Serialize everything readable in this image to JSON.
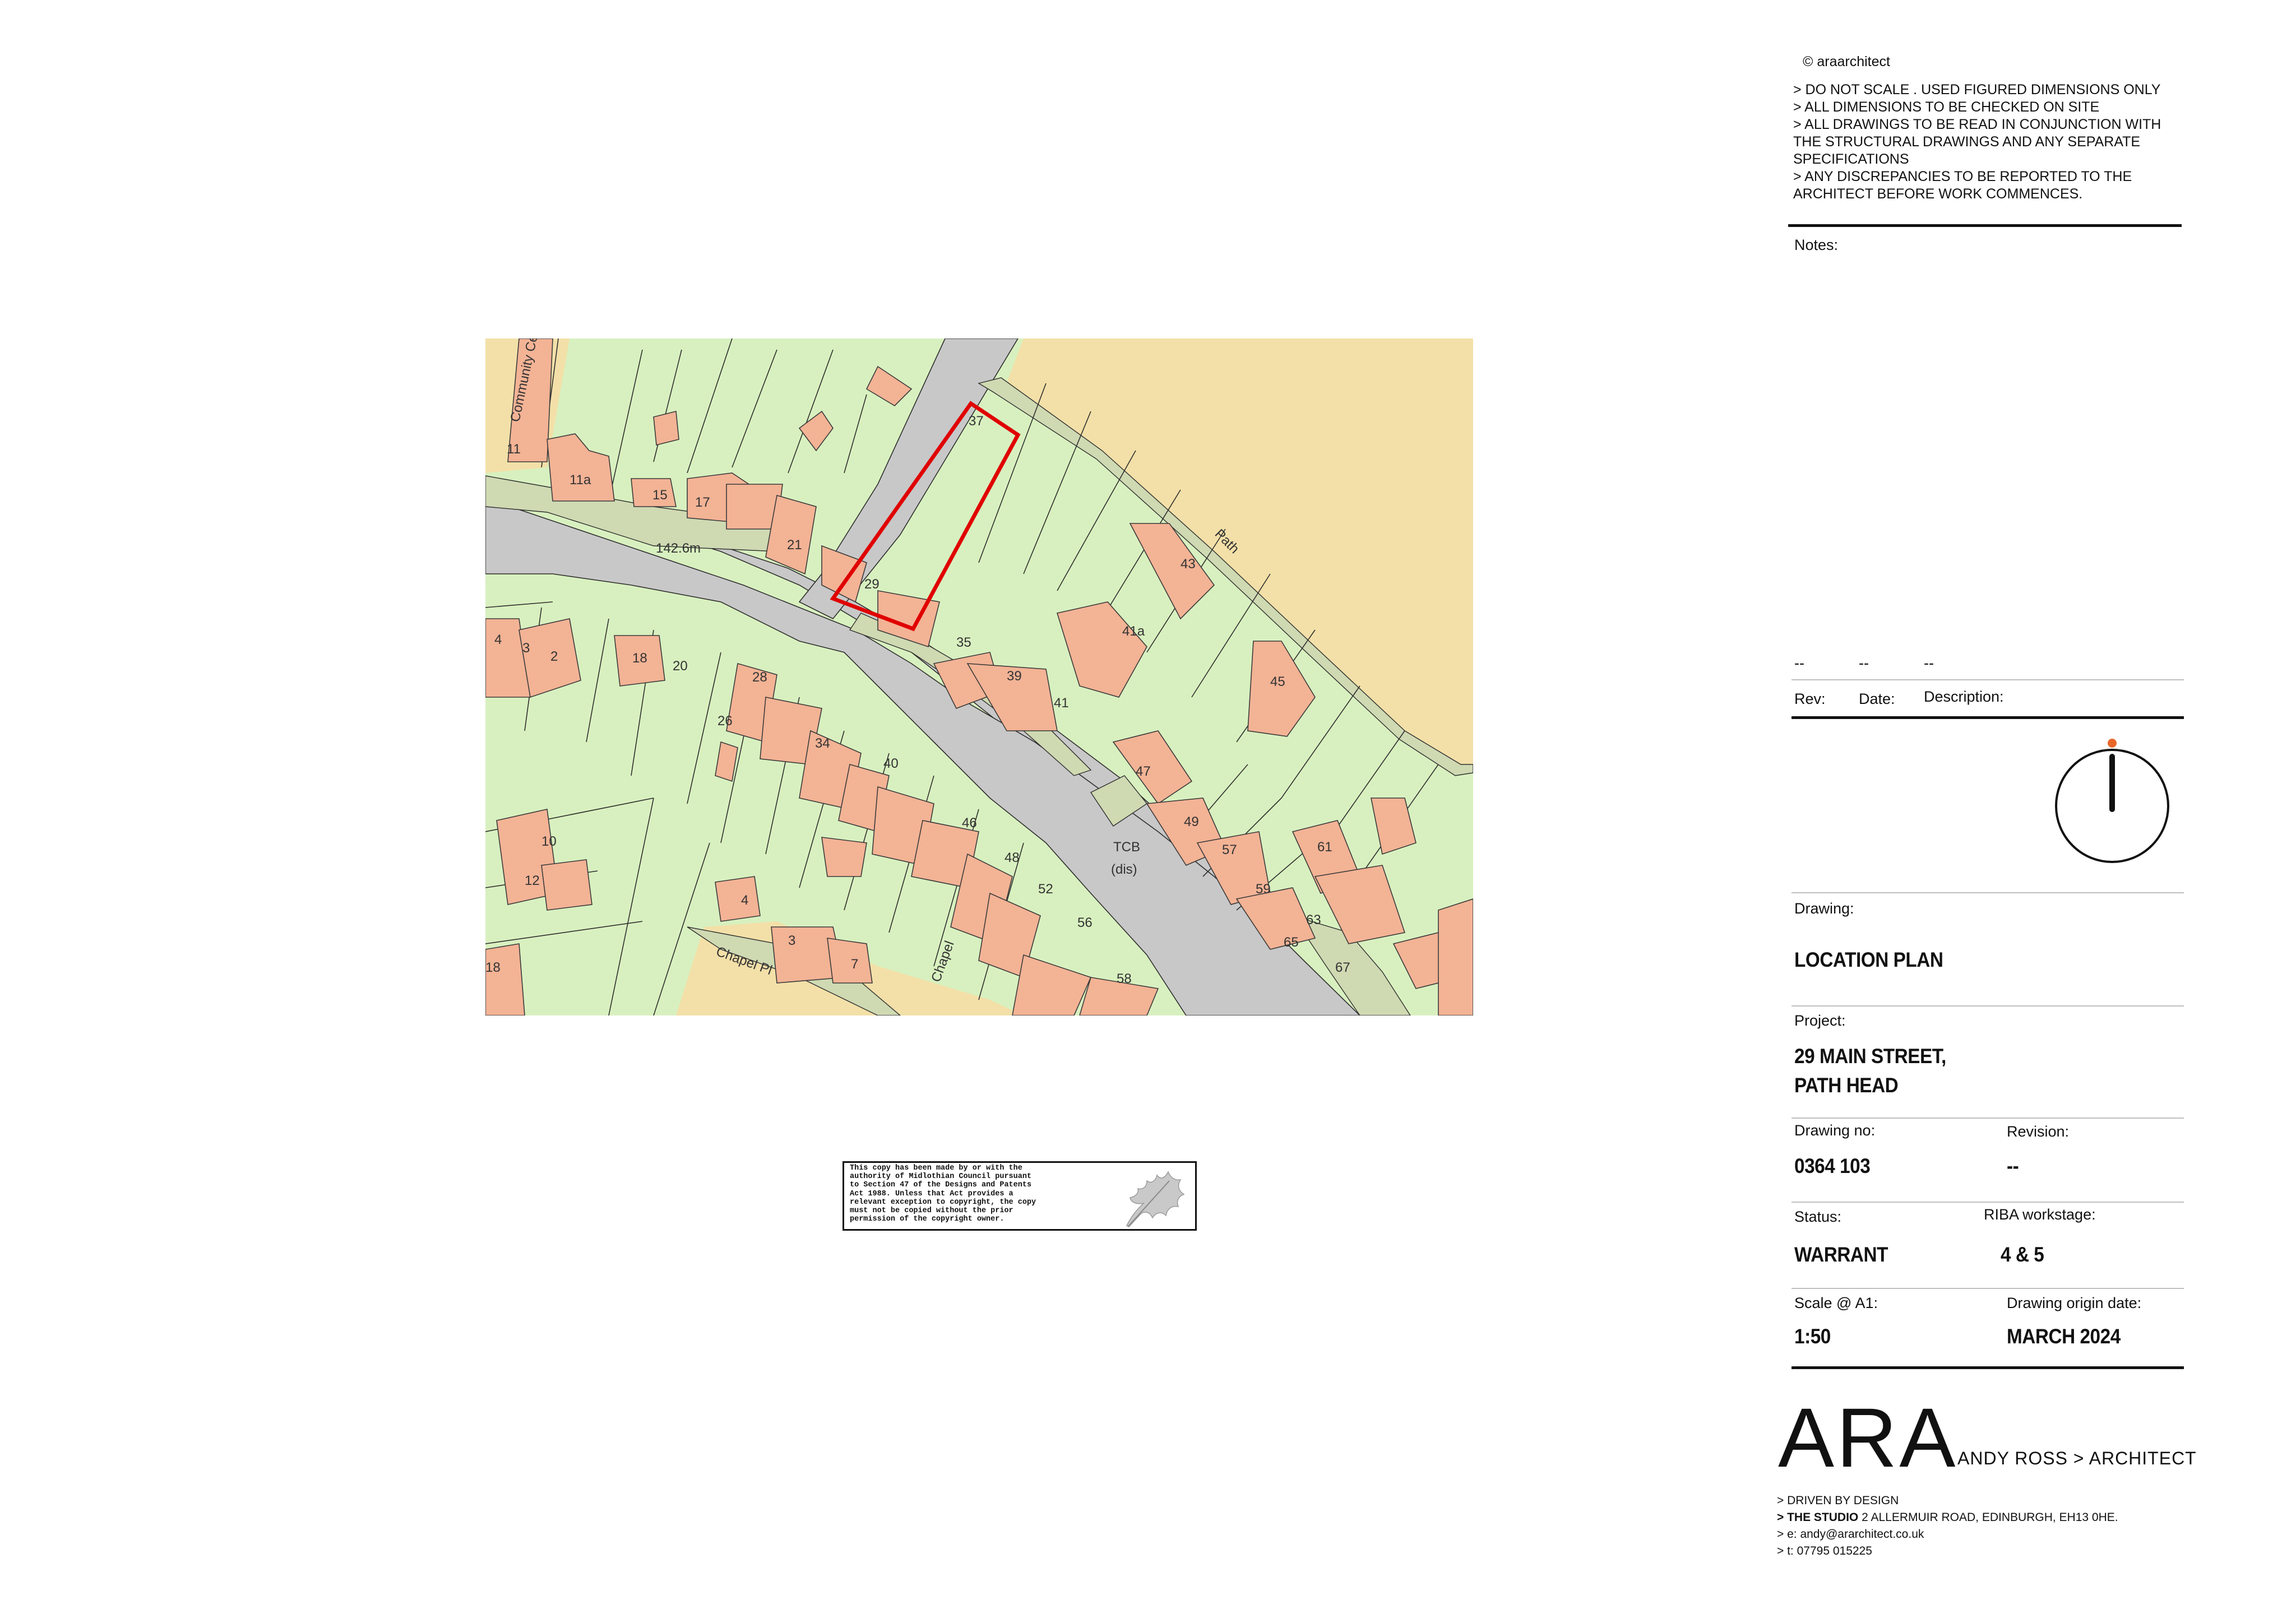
{
  "map": {
    "labels": {
      "community_centre": "Community Centre",
      "n11": "11",
      "n11a": "11a",
      "n15": "15",
      "n17": "17",
      "n21": "21",
      "n29": "29",
      "n35": "35",
      "n37": "37",
      "n39": "39",
      "n41": "41",
      "n41a": "41a",
      "n43": "43",
      "n45": "45",
      "n47": "47",
      "n49": "49",
      "n57": "57",
      "n59": "59",
      "n61": "61",
      "n63": "63",
      "n65": "65",
      "n67": "67",
      "n2": "2",
      "n3": "3",
      "n4": "4",
      "n4b": "4",
      "n7": "7",
      "n10": "10",
      "n12": "12",
      "n18": "18",
      "n18b": "18",
      "n20": "20",
      "n26": "26",
      "n28": "28",
      "n34": "34",
      "n40": "40",
      "n46": "46",
      "n48": "48",
      "n52": "52",
      "n56": "56",
      "n58": "58",
      "n3b": "3",
      "path": "Path",
      "spot_height": "142.6m",
      "tcb": "TCB",
      "dis": "(dis)",
      "chapel": "Chapel",
      "chapel_pl": "Chapel Pl"
    }
  },
  "stamp": {
    "text": "This copy has been made by or with the\nauthority of Midlothian Council pursuant\nto Section 47 of the Designs and Patents\nAct 1988. Unless that Act provides a\nrelevant exception to copyright, the copy\nmust not be copied without the prior\npermission of the copyright owner."
  },
  "title_block": {
    "copyright": "© araarchitect",
    "disclaimer": "> DO NOT SCALE . USED FIGURED DIMENSIONS ONLY\n> ALL DIMENSIONS TO BE CHECKED ON SITE\n> ALL DRAWINGS TO BE READ IN CONJUNCTION WITH\nTHE STRUCTURAL DRAWINGS AND ANY SEPARATE\nSPECIFICATIONS\n> ANY DISCREPANCIES TO BE REPORTED TO THE\nARCHITECT BEFORE WORK COMMENCES.",
    "notes_label": "Notes:",
    "rev_values": [
      "--",
      "--",
      "--"
    ],
    "rev_label": "Rev:",
    "date_label": "Date:",
    "description_label": "Description:",
    "drawing_label": "Drawing:",
    "drawing_value": "LOCATION PLAN",
    "project_label": "Project:",
    "project_line1": "29 MAIN STREET,",
    "project_line2": "PATH HEAD",
    "drawing_no_label": "Drawing no:",
    "drawing_no_value": "0364 103",
    "revision_label": "Revision:",
    "revision_value": "--",
    "status_label": "Status:",
    "status_value": "WARRANT",
    "riba_label": "RIBA workstage:",
    "riba_value": "4 & 5",
    "scale_label": "Scale @ A1:",
    "scale_value": "1:50",
    "origin_date_label": "Drawing origin date:",
    "origin_date_value": "MARCH 2024"
  },
  "branding": {
    "logo": "ARA",
    "tagline": "ANDY ROSS > ARCHITECT",
    "line1": "> DRIVEN BY DESIGN",
    "line2_bold": "> THE STUDIO",
    "line2_rest": " 2 ALLERMUIR ROAD, EDINBURGH, EH13 0HE.",
    "line3": "> e: andy@ararchitect.co.uk",
    "line4": "> t:  07795 015225"
  },
  "colors": {
    "plot": "#d8f0bf",
    "building": "#f3b395",
    "road": "#c8c8c8",
    "field": "#f3e0a8",
    "site_boundary": "#e00000",
    "north_dot": "#e8682a"
  },
  "icons": {
    "north_point": "north-arrow-icon",
    "stamp_leaf": "oak-leaf-icon"
  }
}
